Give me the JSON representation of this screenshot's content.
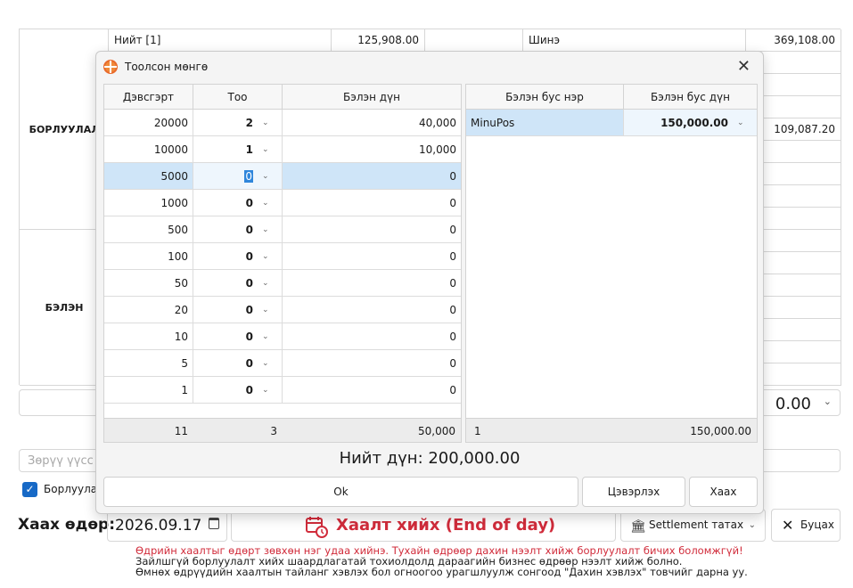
{
  "background": {
    "summary_row": {
      "label": "Нийт [1]",
      "amount": "125,908.00",
      "new_label": "Шинэ",
      "new_amount": "369,108.00"
    },
    "side_amount": "109,087.20",
    "sections": [
      "БОРЛУУЛАЛ",
      "БЭЛЭН"
    ],
    "combo_value": "0.00",
    "note_placeholder": "Зөрүү үүсс",
    "checkbox_label": "Борлуулал",
    "close_date_label": "Хаах өдөр:",
    "close_date_value": "2026.09.17",
    "eod_button": "Хаалт хийх (End of day)",
    "settlement_button": "Settlement татах",
    "back_button": "Буцах",
    "messages": [
      "Өдрийн хаалтыг өдөрт зөвхөн нэг удаа хийнэ. Тухайн өдрөөр дахин нээлт хийж борлуулалт бичих боломжгүй!",
      "Зайлшгүй борлуулалт хийх шаардлагатай тохиолдолд дараагийн бизнес өдрөөр нээлт хийж болно.",
      "Өмнөх өдрүүдийн хаалтын тайланг хэвлэх бол огноогоо урагшлуулж сонгоод \"Дахин хэвлэх\" товчийг дарна уу."
    ],
    "colors": {
      "danger": "#d12c3b",
      "accent": "#1769c6"
    }
  },
  "dialog": {
    "title": "Тоолсон мөнгө",
    "cash_grid": {
      "headers": [
        "Дэвсгэрт",
        "Тоо",
        "Бэлэн дүн"
      ],
      "rows": [
        {
          "note": "20000",
          "count": "2",
          "amount": "40,000"
        },
        {
          "note": "10000",
          "count": "1",
          "amount": "10,000"
        },
        {
          "note": "5000",
          "count": "0",
          "amount": "0"
        },
        {
          "note": "1000",
          "count": "0",
          "amount": "0"
        },
        {
          "note": "500",
          "count": "0",
          "amount": "0"
        },
        {
          "note": "100",
          "count": "0",
          "amount": "0"
        },
        {
          "note": "50",
          "count": "0",
          "amount": "0"
        },
        {
          "note": "20",
          "count": "0",
          "amount": "0"
        },
        {
          "note": "10",
          "count": "0",
          "amount": "0"
        },
        {
          "note": "5",
          "count": "0",
          "amount": "0"
        },
        {
          "note": "1",
          "count": "0",
          "amount": "0"
        }
      ],
      "footer": {
        "rows_count": "11",
        "count_total": "3",
        "amount_total": "50,000"
      }
    },
    "noncash_grid": {
      "headers": [
        "Бэлэн бус нэр",
        "Бэлэн бус дүн"
      ],
      "rows": [
        {
          "name": "MinuPos",
          "amount": "150,000.00"
        }
      ],
      "footer": {
        "rows_count": "1",
        "amount_total": "150,000.00"
      }
    },
    "grand_total": "Нийт дүн: 200,000.00",
    "buttons": {
      "ok": "Ok",
      "clear": "Цэвэрлэх",
      "close": "Хаах"
    }
  }
}
